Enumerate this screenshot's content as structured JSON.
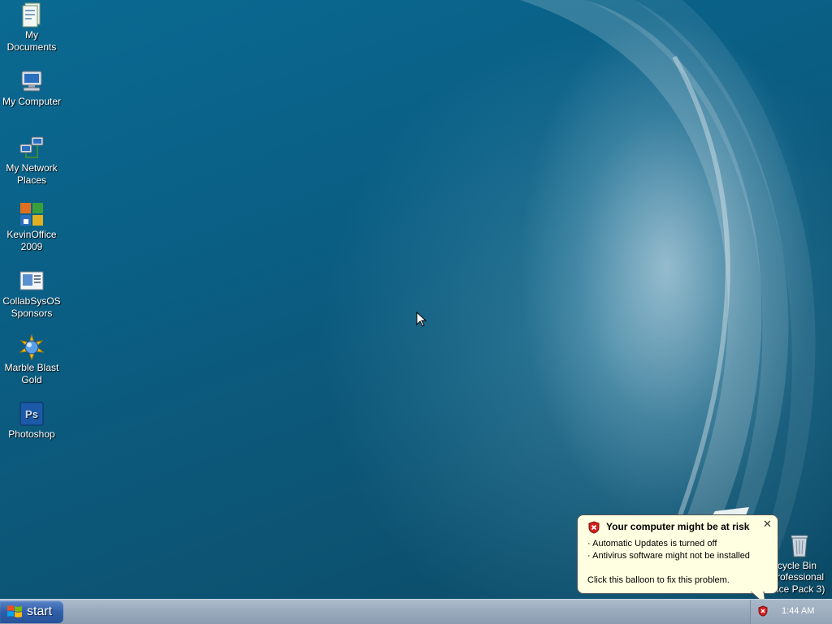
{
  "desktop": {
    "icons": [
      {
        "label_1": "My",
        "label_2": "Documents"
      },
      {
        "label_1": "My Computer",
        "label_2": ""
      },
      {
        "label_1": "My Network",
        "label_2": "Places"
      },
      {
        "label_1": "KevinOffice",
        "label_2": "2009"
      },
      {
        "label_1": "CollabSysOS",
        "label_2": "Sponsors"
      },
      {
        "label_1": "Marble Blast",
        "label_2": "Gold"
      },
      {
        "label_1": "Photoshop",
        "label_2": ""
      }
    ],
    "recycle_bin": {
      "label": "cycle Bin"
    },
    "edition_watermark": {
      "line_1": "rofessional",
      "line_2": "ice Pack 3)"
    },
    "photoshop_icon_text": "Ps"
  },
  "balloon": {
    "title": "Your computer might be at risk",
    "line_1": "· Automatic Updates is turned off",
    "line_2": "· Antivirus software might not be installed",
    "line_3": "Click this balloon to fix this problem.",
    "close_glyph": "✕",
    "icon": "security-shield-icon"
  },
  "taskbar": {
    "start_label": "start",
    "clock": "1:44 AM",
    "tray_icon": "security-alert-icon"
  },
  "colors": {
    "wallpaper_blue": "#0a5f85",
    "taskbar": "#9cacbf",
    "start_button": "#2f5ea8",
    "balloon_bg": "#ffffe1",
    "alert_red": "#d42020"
  }
}
